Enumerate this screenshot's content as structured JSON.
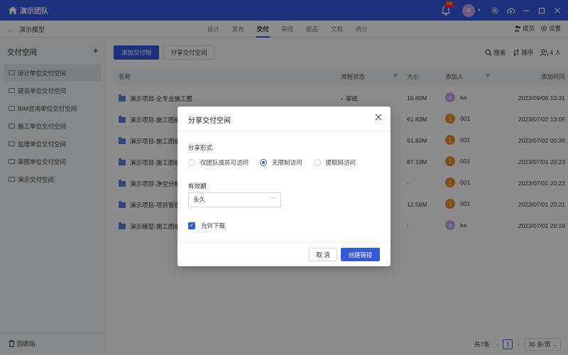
{
  "colors": {
    "primary": "#3558e0",
    "avatar_a": "#c9a6ea",
    "avatar_1": "#e8902b",
    "status_dot": "#3558e0"
  },
  "topbar": {
    "team_name": "演示团队",
    "notification_count": "64",
    "user_initial": "a"
  },
  "subbar": {
    "project": "演示模型",
    "tabs": [
      "设计",
      "发布",
      "交付",
      "审阅",
      "部品",
      "文档",
      "统计"
    ],
    "active_tab": "交付",
    "members_label": "成员",
    "settings_label": "设置"
  },
  "sidebar": {
    "title": "交付空间",
    "items": [
      {
        "label": "设计单位交付空间"
      },
      {
        "label": "建设单位交付空间"
      },
      {
        "label": "BIM咨询单位交付空间"
      },
      {
        "label": "施工单位交付空间"
      },
      {
        "label": "监理单位交付空间"
      },
      {
        "label": "审图单位交付空间"
      },
      {
        "label": "演示交付空间"
      }
    ],
    "recycle_bin": "回收站"
  },
  "main": {
    "add_button": "添加交付物",
    "share_button": "分享交付空间",
    "search_label": "搜索",
    "sort_label": "排序",
    "people_count": "4 人",
    "columns": {
      "name": "名称",
      "status": "流程状态",
      "size": "大小",
      "adder": "添加人",
      "time": "添加时间"
    },
    "rows": [
      {
        "name": "演示项目-全专业施工图",
        "status": "审纸",
        "size": "16.80M",
        "avatar": "a",
        "user": "ka",
        "time": "2023/09/06 10:31"
      },
      {
        "name": "演示项目-施工图纸",
        "status": "",
        "size": "61.83M",
        "avatar": "1",
        "user": "001",
        "time": "2023/07/02 13:05"
      },
      {
        "name": "演示项目-施工图纸",
        "status": "",
        "size": "61.83M",
        "avatar": "1",
        "user": "001",
        "time": "2023/07/02 00:39"
      },
      {
        "name": "演示项目-施工图纸",
        "status": "",
        "size": "87.19M",
        "avatar": "1",
        "user": "001",
        "time": "2023/07/01 20:23"
      },
      {
        "name": "演示项目-净空分析",
        "status": "",
        "size": "-",
        "avatar": "1",
        "user": "001",
        "time": "2023/07/01 20:22"
      },
      {
        "name": "演示项目-项目管理",
        "status": "",
        "size": "12.56M",
        "avatar": "1",
        "user": "001",
        "time": "2023/07/01 20:21"
      },
      {
        "name": "演示模型-施工图纸",
        "status": "",
        "size": "-",
        "avatar": "a",
        "user": "ka",
        "time": "2023/07/01 20:18"
      }
    ],
    "pager": {
      "total": "共7条",
      "current_page": "1",
      "page_size": "30 条/页"
    }
  },
  "modal": {
    "title": "分享交付空间",
    "share_type_label": "分享形式",
    "options": [
      "仅团队成员可访问",
      "无限制访问",
      "提取码访问"
    ],
    "selected_option": "无限制访问",
    "validity_label": "有效期",
    "validity_value": "永久",
    "allow_download_label": "允许下载",
    "allow_download": true,
    "cancel_label": "取 消",
    "create_label": "创建链接"
  }
}
